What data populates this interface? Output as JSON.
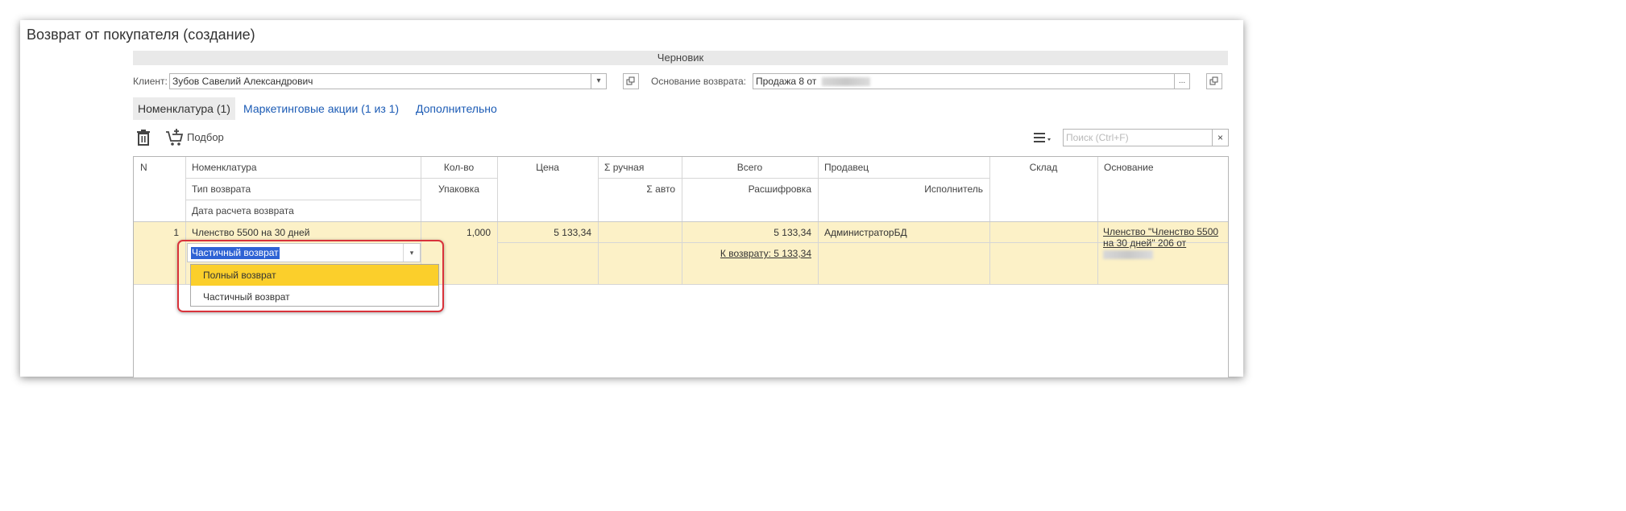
{
  "window": {
    "title": "Возврат от покупателя (создание)"
  },
  "status": "Черновик",
  "client": {
    "label": "Клиент:",
    "value": "Зубов Савелий Александрович"
  },
  "basis": {
    "label": "Основание возврата:",
    "value": "Продажа 8 от"
  },
  "tabs": [
    {
      "label": "Номенклатура (1)"
    },
    {
      "label": "Маркетинговые акции (1 из 1)"
    },
    {
      "label": "Дополнительно"
    }
  ],
  "toolbar": {
    "pick_label": "Подбор",
    "search_placeholder": "Поиск (Ctrl+F)",
    "search_clear": "×"
  },
  "table": {
    "headers": {
      "n": "N",
      "nomenclature": "Номенклатура",
      "return_type": "Тип возврата",
      "return_date": "Дата расчета возврата",
      "qty": "Кол-во",
      "pack": "Упаковка",
      "price": "Цена",
      "manual_sum": "Σ ручная",
      "auto_sum": "Σ авто",
      "total": "Всего",
      "decode": "Расшифровка",
      "seller": "Продавец",
      "executor": "Исполнитель",
      "warehouse": "Склад",
      "basis": "Основание"
    },
    "rows": [
      {
        "n": "1",
        "nomenclature": "Членство 5500 на 30 дней",
        "return_type": "Частичный возврат",
        "qty": "1,000",
        "price": "5 133,34",
        "total": "5 133,34",
        "to_return": "К возврату: 5 133,34",
        "seller": "АдминистраторБД",
        "basis": "Членство \"Членство 5500 на 30 дней\" 206 от"
      }
    ]
  },
  "dropdown": {
    "options": [
      "Полный возврат",
      "Частичный возврат"
    ],
    "selected_index": 0
  },
  "colors": {
    "row_highlight": "#fcf1c7",
    "dropdown_selected": "#fbcf2b",
    "callout": "#d9333b",
    "link": "#1b5bb5"
  }
}
